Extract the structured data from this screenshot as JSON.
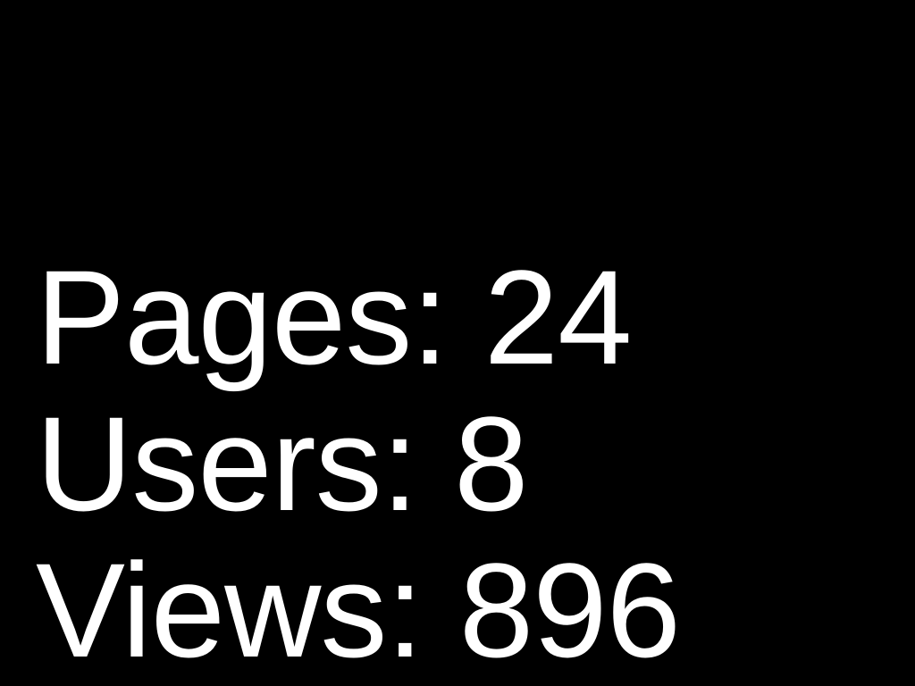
{
  "colors": {
    "background": "#000000",
    "text": "#ffffff"
  },
  "stats": [
    {
      "label": "Pages:",
      "value": "24"
    },
    {
      "label": "Users:",
      "value": "8"
    },
    {
      "label": "Views:",
      "value": "896"
    }
  ]
}
